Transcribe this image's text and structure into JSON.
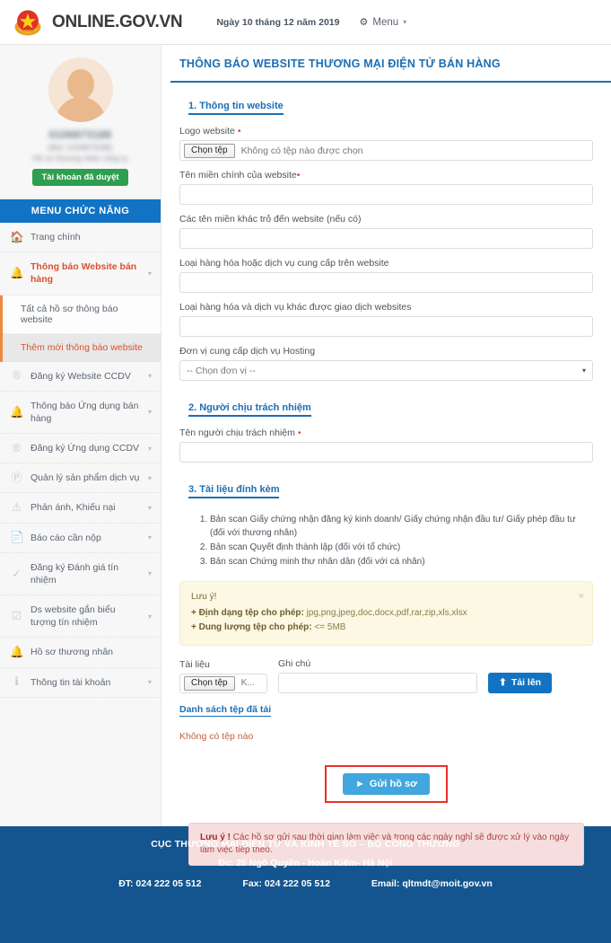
{
  "header": {
    "brand": "ONLINE.GOV.VN",
    "date": "Ngày 10 tháng 12 năm 2019",
    "menu_label": "Menu",
    "gear_icon": "gear-icon",
    "caret_icon": "chevron-down-icon",
    "emblem_icon": "vietnam-emblem-icon"
  },
  "sidebar": {
    "user": {
      "id": "0106873188",
      "sub": "(Mst: 0106873188)",
      "org": "Hộ cơ thương nhân công ty",
      "badge": "Tài khoản đã duyệt"
    },
    "menu_title": "MENU CHỨC NĂNG",
    "items": [
      {
        "label": "Trang chính",
        "icon": "home-icon",
        "caret": false,
        "alert": false
      },
      {
        "label": "Thông báo Website bán hàng",
        "icon": "bell-icon",
        "caret": true,
        "alert": true
      },
      {
        "label": "Đăng ký Website CCDV",
        "icon": "registered-icon",
        "caret": true,
        "alert": false
      },
      {
        "label": "Thông báo Ứng dụng bán hàng",
        "icon": "bell-outline-icon",
        "caret": true,
        "alert": false
      },
      {
        "label": "Đăng ký Ứng dụng CCDV",
        "icon": "registered-icon",
        "caret": true,
        "alert": false
      },
      {
        "label": "Quản lý sản phẩm dịch vụ",
        "icon": "product-icon",
        "caret": true,
        "alert": false
      },
      {
        "label": "Phản ánh, Khiếu nại",
        "icon": "warning-icon",
        "caret": true,
        "alert": false
      },
      {
        "label": "Báo cáo cần nộp",
        "icon": "document-icon",
        "caret": true,
        "alert": false
      },
      {
        "label": "Đăng ký Đánh giá tín nhiệm",
        "icon": "check-circle-icon",
        "caret": true,
        "alert": false
      },
      {
        "label": "Ds website gắn biểu tượng tín nhiệm",
        "icon": "checkbox-icon",
        "caret": true,
        "alert": false
      },
      {
        "label": "Hồ sơ thương nhân",
        "icon": "bell-outline-icon",
        "caret": false,
        "alert": false
      },
      {
        "label": "Thông tin tài khoản",
        "icon": "info-icon",
        "caret": true,
        "alert": false
      }
    ],
    "subitems": [
      {
        "label": "Tất cả hồ sơ thông báo website",
        "active": false
      },
      {
        "label": "Thêm mới thông báo website",
        "active": true
      }
    ]
  },
  "main": {
    "page_title": "THÔNG BÁO WEBSITE THƯƠNG MẠI ĐIỆN TỬ BÁN HÀNG",
    "section1": {
      "heading": "1. Thông tin website",
      "fields": [
        {
          "label": "Logo website",
          "required": true,
          "type": "file",
          "button": "Chọn tệp",
          "text": "Không có tệp nào được chọn"
        },
        {
          "label": "Tên miền chính của website",
          "required": true,
          "type": "text",
          "value": ""
        },
        {
          "label": "Các tên miền khác trỏ đến website (nếu có)",
          "required": false,
          "type": "text",
          "value": ""
        },
        {
          "label": "Loại hàng hóa hoặc dịch vụ cung cấp trên website",
          "required": false,
          "type": "text",
          "value": ""
        },
        {
          "label": "Loại hàng hóa và dịch vụ khác được giao dịch websites",
          "required": false,
          "type": "text",
          "value": ""
        },
        {
          "label": "Đơn vị cung cấp dịch vụ Hosting",
          "required": false,
          "type": "select",
          "value": "-- Chọn đơn vị --"
        }
      ]
    },
    "section2": {
      "heading": "2. Người chịu trách nhiệm",
      "field_label": "Tên người chịu trách nhiệm",
      "required": true,
      "value": ""
    },
    "section3": {
      "heading": "3. Tài liệu đính kèm",
      "docs": [
        "Bản scan Giấy chứng nhận đăng ký kinh doanh/ Giấy chứng nhận đầu tư/ Giấy phép đầu tư (đối với thương nhân)",
        "Bản scan Quyết định thành lập (đối với tổ chức)",
        "Bản scan Chứng minh thư nhân dân (đối với cá nhân)"
      ],
      "notice": {
        "title": "Lưu ý!",
        "line1_label": "+ Định dạng tệp cho phép",
        "line1_value": "jpg,png,jpeg,doc,docx,pdf,rar,zip,xls,xlsx",
        "line2_label": "+ Dung lượng tệp cho phép",
        "line2_value": "<= 5MB",
        "close_icon": "close-icon"
      },
      "upload": {
        "file_label": "Tài liệu",
        "file_button": "Chọn tệp",
        "file_text": "K...",
        "note_label": "Ghi chú",
        "note_value": "",
        "upload_button": "Tải lên",
        "upload_icon": "upload-icon"
      },
      "files_link": "Danh sách tệp đã tải",
      "no_files": "Không có tệp nào"
    },
    "submit": {
      "label": "Gửi hồ sơ",
      "icon": "paper-plane-icon"
    },
    "warning": {
      "bold": "Lưu ý !",
      "text": " Các hồ sơ gửi sau thời gian làm việc và trong các ngày nghỉ sẽ được xử lý vào ngày làm việc tiếp theo."
    }
  },
  "footer": {
    "line1": "CỤC THƯƠNG MẠI ĐIỆN TỬ VÀ KINH TẾ SỐ – BỘ CÔNG THƯƠNG",
    "line2": "Đc: 25 Ngô Quyền - Hoàn Kiếm- Hà Nội",
    "phone": "ĐT: 024 222 05 512",
    "fax": "Fax: 024 222 05 512",
    "email": "Email: qltmdt@moit.gov.vn"
  },
  "colors": {
    "brand_blue": "#1273c4",
    "footer_blue": "#14558f",
    "accent_orange": "#d9512c",
    "submit_blue": "#41a7de",
    "highlight_red": "#e8312a",
    "approved_green": "#2e9e4f"
  }
}
